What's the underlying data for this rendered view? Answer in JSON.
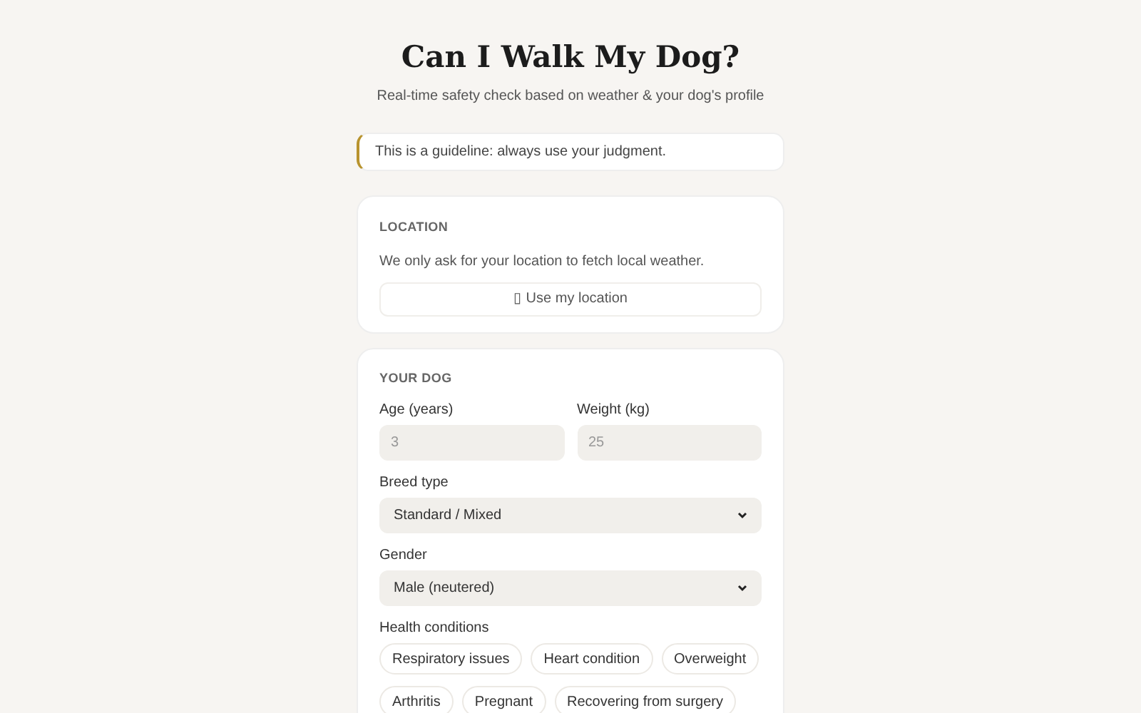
{
  "header": {
    "title": "Can I Walk My Dog?",
    "subtitle": "Real-time safety check based on weather & your dog's profile"
  },
  "notice": "This is a guideline: always use your judgment.",
  "location": {
    "heading": "LOCATION",
    "text": "We only ask for your location to fetch local weather.",
    "button": "▯ Use my location"
  },
  "dog": {
    "heading": "YOUR DOG",
    "age": {
      "label": "Age (years)",
      "placeholder": "3"
    },
    "weight": {
      "label": "Weight (kg)",
      "placeholder": "25"
    },
    "breed": {
      "label": "Breed type",
      "value": "Standard / Mixed"
    },
    "gender": {
      "label": "Gender",
      "value": "Male (neutered)"
    },
    "health": {
      "label": "Health conditions",
      "options": [
        {
          "label": "Respiratory issues",
          "selected": false
        },
        {
          "label": "Heart condition",
          "selected": false
        },
        {
          "label": "Overweight",
          "selected": false
        },
        {
          "label": "Arthritis",
          "selected": false
        },
        {
          "label": "Pregnant",
          "selected": false
        },
        {
          "label": "Recovering from surgery",
          "selected": false
        }
      ]
    }
  }
}
